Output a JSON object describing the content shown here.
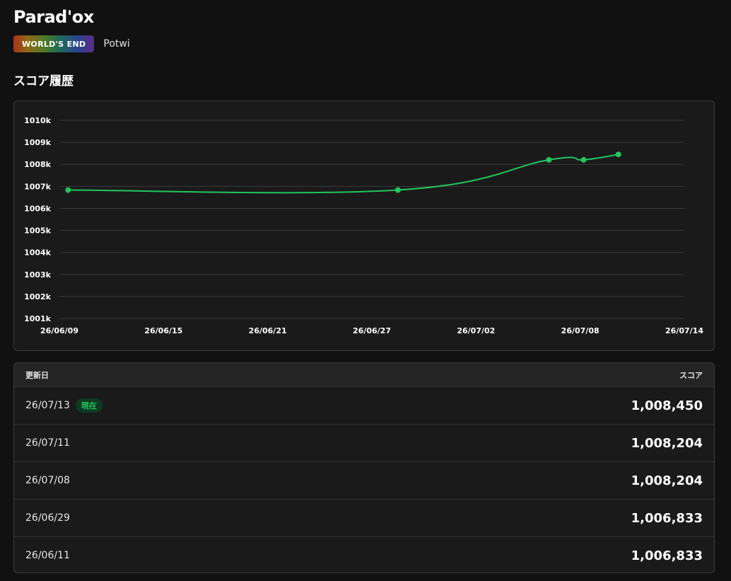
{
  "song": {
    "title": "Parad'ox",
    "difficulty": "WORLD'S END",
    "artist": "Potwi"
  },
  "section_title": "スコア履歴",
  "colors": {
    "line": "#22c55e",
    "background": "#111111",
    "card": "#1a1a1a",
    "badge_bg": "#0f3a22"
  },
  "chart_data": {
    "type": "line",
    "title": "",
    "xlabel": "",
    "ylabel": "",
    "x_ticks": [
      "26/06/09",
      "26/06/15",
      "26/06/21",
      "26/06/27",
      "26/07/02",
      "26/07/08",
      "26/07/14"
    ],
    "x_tick_days": [
      0,
      6,
      12,
      18,
      24,
      30,
      36
    ],
    "y_ticks": [
      "1001k",
      "1002k",
      "1003k",
      "1004k",
      "1005k",
      "1006k",
      "1007k",
      "1008k",
      "1009k",
      "1010k"
    ],
    "ylim": [
      1001000,
      1010000
    ],
    "grid": true,
    "legend": "none",
    "series": [
      {
        "dates": [
          "26/06/11",
          "26/06/29",
          "26/07/08",
          "26/07/11",
          "26/07/13"
        ],
        "x_days": [
          0.5,
          19.5,
          28.2,
          30.2,
          32.2
        ],
        "values": [
          1006833,
          1006833,
          1008204,
          1008204,
          1008450
        ]
      }
    ]
  },
  "history": {
    "header_date": "更新日",
    "header_score": "スコア",
    "current_label": "現在",
    "rows": [
      {
        "date": "26/07/13",
        "score": "1,008,450"
      },
      {
        "date": "26/07/11",
        "score": "1,008,204"
      },
      {
        "date": "26/07/08",
        "score": "1,008,204"
      },
      {
        "date": "26/06/29",
        "score": "1,006,833"
      },
      {
        "date": "26/06/11",
        "score": "1,006,833"
      }
    ]
  }
}
